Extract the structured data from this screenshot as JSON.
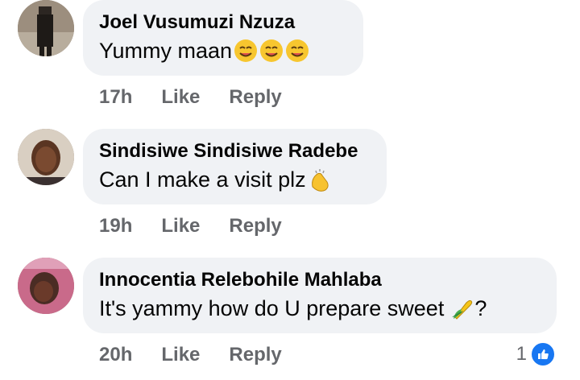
{
  "comments": [
    {
      "name": "Joel Vusumuzi Nzuza",
      "text": "Yummy maan",
      "time": "17h",
      "like_label": "Like",
      "reply_label": "Reply",
      "emoji": [
        "smiling-face-icon",
        "smiling-face-icon",
        "smiling-face-icon"
      ]
    },
    {
      "name": "Sindisiwe Sindisiwe Radebe",
      "text": "Can I make a visit plz",
      "time": "19h",
      "like_label": "Like",
      "reply_label": "Reply",
      "emoji": [
        "clapping-hands-icon"
      ]
    },
    {
      "name": "Innocentia Relebohile Mahlaba",
      "text": "It's yammy how do U prepare sweet",
      "text_suffix": "?",
      "time": "20h",
      "like_label": "Like",
      "reply_label": "Reply",
      "emoji": [
        "corn-icon"
      ],
      "reaction_count": "1",
      "reaction_icon": "thumbs-up-icon"
    }
  ],
  "colors": {
    "bubble": "#f0f2f5",
    "secondary_text": "#65676b",
    "like_blue": "#1877f2"
  }
}
